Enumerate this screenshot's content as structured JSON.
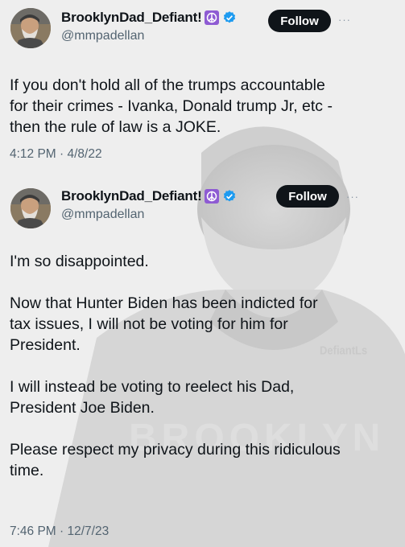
{
  "tweets": [
    {
      "display_name": "BrooklynDad_Defiant!",
      "handle": "@mmpadellan",
      "follow_label": "Follow",
      "more_label": "···",
      "text": [
        "If you don't hold all of the trumps accountable\nfor their crimes - Ivanka, Donald trump Jr, etc -\nthen the rule of law is a JOKE."
      ],
      "timestamp": "4:12 PM · 4/8/22"
    },
    {
      "display_name": "BrooklynDad_Defiant!",
      "handle": "@mmpadellan",
      "follow_label": "Follow",
      "more_label": "···",
      "text": [
        "I'm so disappointed.",
        "Now that Hunter Biden has been indicted for\ntax issues, I will not be voting for him for\nPresident.",
        "I will instead be voting to reelect his Dad,\nPresident Joe Biden.",
        "Please respect my privacy during this ridiculous\ntime."
      ],
      "timestamp": "7:46 PM · 12/7/23"
    }
  ],
  "watermark": "DefiantLs",
  "icons": {
    "peace": "peace-symbol-icon",
    "verified": "verified-badge-icon",
    "more": "more-dots-icon"
  },
  "colors": {
    "verified_blue": "#1d9bf0",
    "peace_purple": "#8e5bd3",
    "follow_bg": "#0f1419"
  }
}
